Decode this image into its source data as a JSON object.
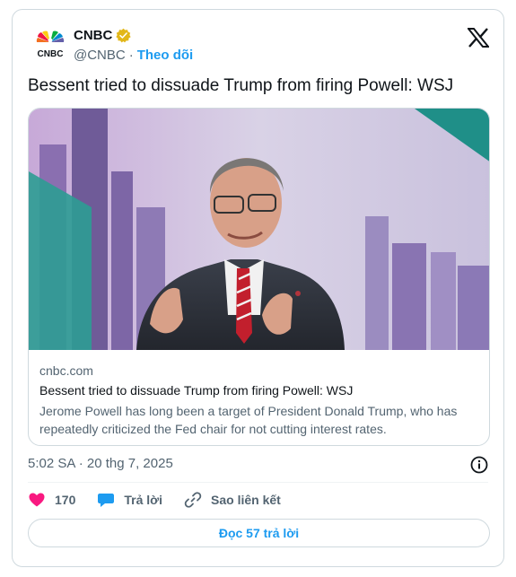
{
  "post": {
    "author_name": "CNBC",
    "author_handle": "@CNBC",
    "separator": "·",
    "follow_label": "Theo dõi",
    "text": "Bessent tried to dissuade Trump from firing Powell: WSJ",
    "timestamp": "5:02 SA · 20 thg 7, 2025"
  },
  "link_card": {
    "domain": "cnbc.com",
    "title": "Bessent tried to dissuade Trump from firing Powell: WSJ",
    "description": "Jerome Powell has long been a target of President Donald Trump, who has repeatedly criticized the Fed chair for not cutting interest rates."
  },
  "actions": {
    "like_count": "170",
    "reply_label": "Trả lời",
    "copy_link_label": "Sao liên kết"
  },
  "replies_button": "Đọc 57 trả lời",
  "icons": {
    "logo": "cnbc-peacock-logo",
    "verified": "gold-verified-badge",
    "platform": "x-logo",
    "info": "info-icon",
    "like": "heart-icon",
    "reply": "speech-bubble-icon",
    "copy_link": "link-icon"
  },
  "colors": {
    "accent": "#1d9bf0",
    "like": "#f91880",
    "verified": "#e2b719",
    "muted_text": "#536471",
    "border": "#cfd9de"
  }
}
